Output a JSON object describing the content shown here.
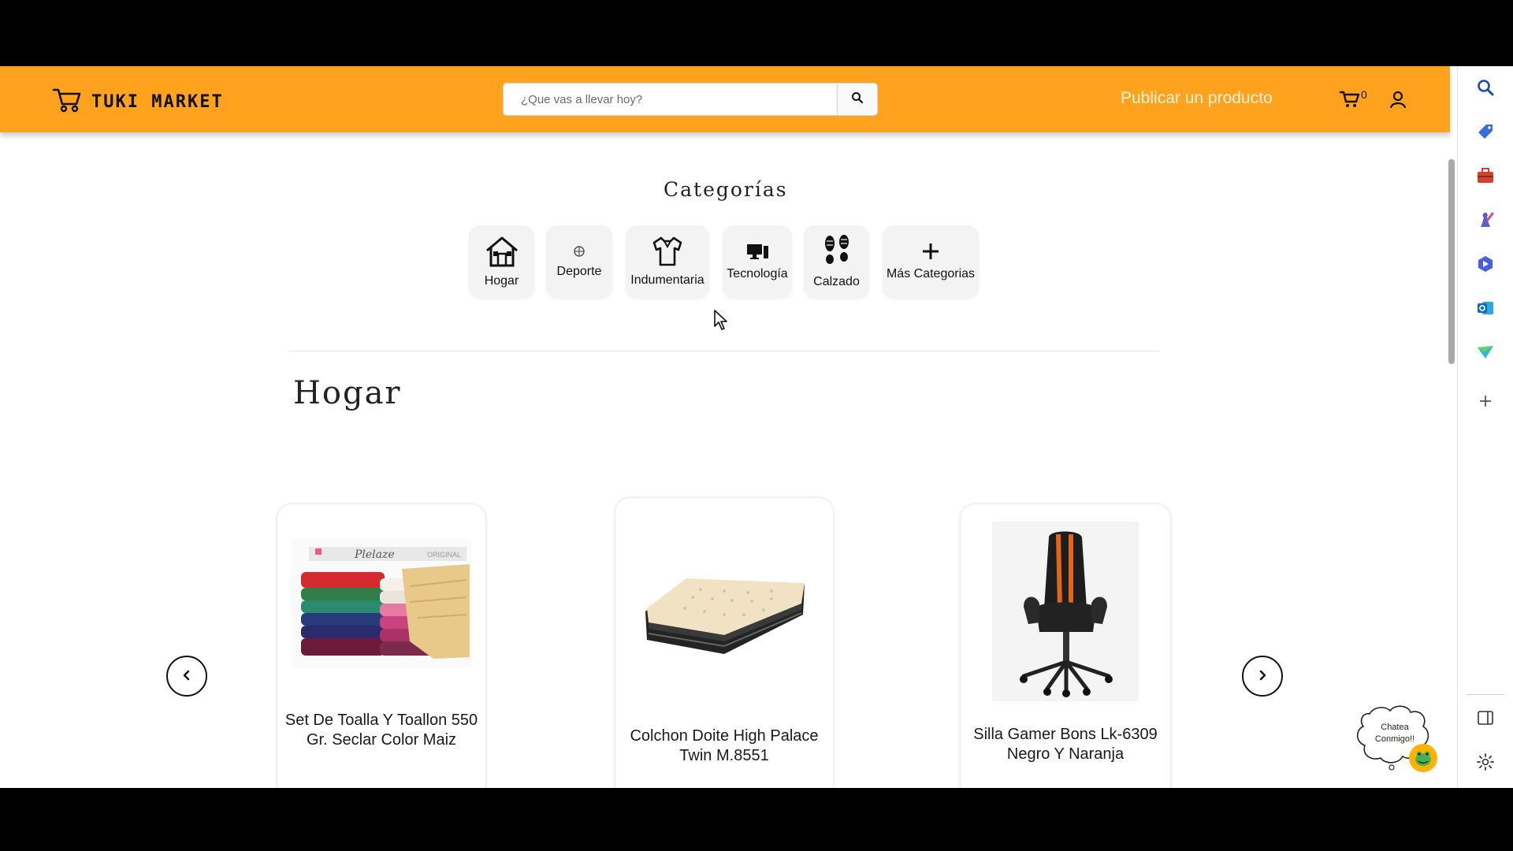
{
  "brand": {
    "name": "TUKI MARKET"
  },
  "search": {
    "placeholder": "¿Que vas a llevar hoy?"
  },
  "nav": {
    "publish_label": "Publicar un producto",
    "cart_count": "0"
  },
  "categories": {
    "title": "Categorías",
    "items": [
      {
        "label": "Hogar",
        "icon": "house-icon"
      },
      {
        "label": "Deporte",
        "icon": "sport-icon"
      },
      {
        "label": "Indumentaria",
        "icon": "shirt-icon"
      },
      {
        "label": "Tecnología",
        "icon": "computer-icon"
      },
      {
        "label": "Calzado",
        "icon": "footprints-icon"
      },
      {
        "label": "Más Categorias",
        "icon": "plus-icon"
      }
    ]
  },
  "section": {
    "title": "Hogar"
  },
  "products": [
    {
      "title": "Set De Toalla Y Toallon 550 Gr. Seclar Color Maiz",
      "image": "towel-stack-image"
    },
    {
      "title": "Colchon Doite High Palace Twin M.8551",
      "image": "air-mattress-image"
    },
    {
      "title": "Silla Gamer Bons Lk-6309 Negro Y Naranja",
      "image": "gaming-chair-image"
    }
  ],
  "chat": {
    "label": "Chatea Conmigo!!"
  },
  "colors": {
    "brand_orange": "#ffa21e",
    "text_dark": "#111111",
    "card_bg": "#f3f3f3"
  },
  "browser_sidebar": {
    "icons": [
      "search-icon",
      "tag-icon",
      "briefcase-icon",
      "chess-icon",
      "copilot-icon",
      "outlook-icon",
      "send-icon",
      "add-icon",
      "sidebar-toggle-icon",
      "settings-icon"
    ]
  }
}
